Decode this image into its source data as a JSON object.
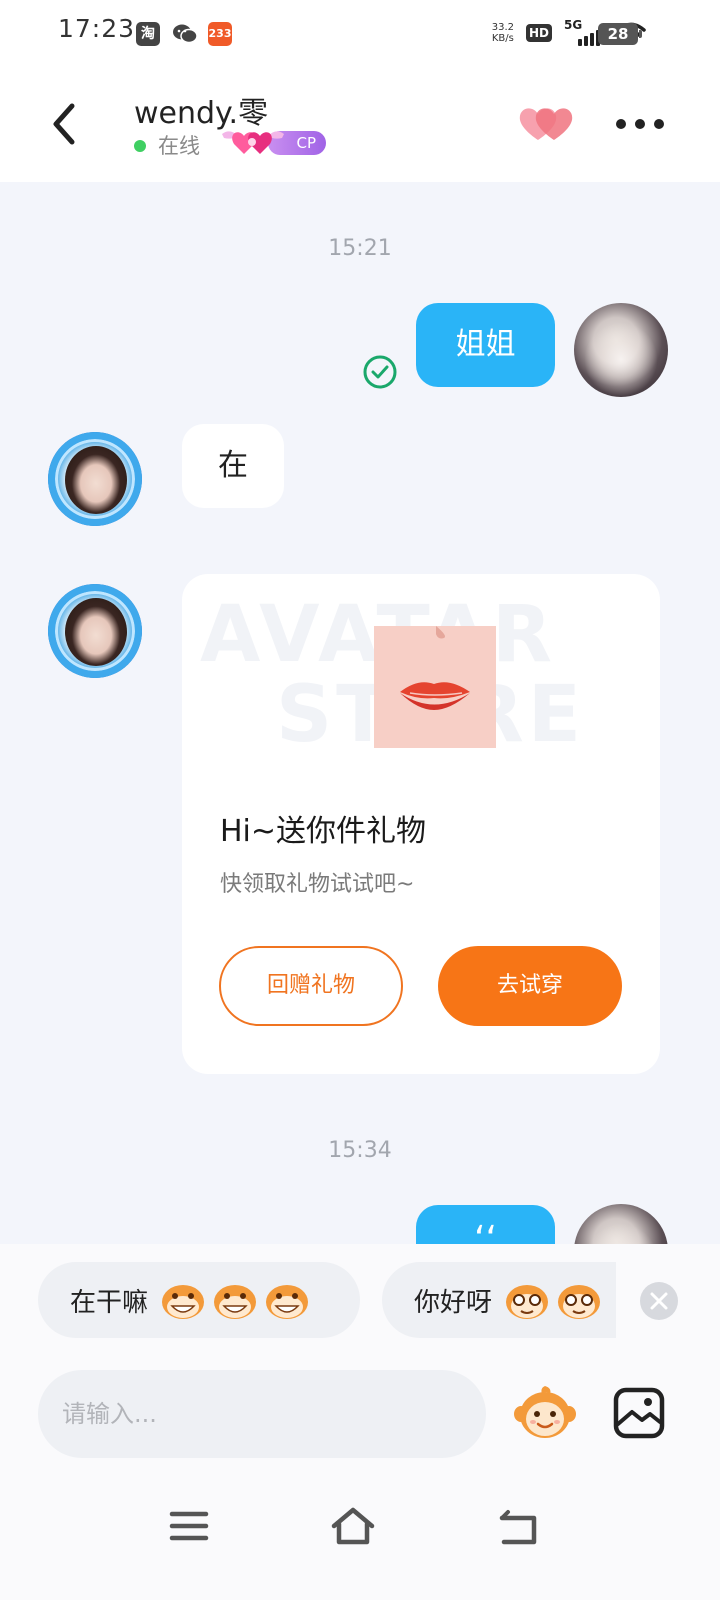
{
  "status_bar": {
    "time": "17:23",
    "apps": [
      "淘",
      "233"
    ],
    "net_speed_value": "33.2",
    "net_speed_unit": "KB/s",
    "hd": "HD",
    "signal": "5G",
    "battery": "28"
  },
  "header": {
    "contact_name": "wendy.零",
    "status": "在线",
    "badge": "CP"
  },
  "chat": {
    "messages": [
      {
        "type": "timestamp",
        "text": "15:21"
      },
      {
        "type": "outgoing",
        "text": "姐姐"
      },
      {
        "type": "incoming",
        "text": "在"
      },
      {
        "type": "gift_card",
        "title": "Hi~送你件礼物",
        "subtitle": "快领取礼物试试吧~",
        "watermark": [
          "AVATAR",
          "STORE"
        ],
        "button_secondary": "回赠礼物",
        "button_primary": "去试穿"
      },
      {
        "type": "timestamp",
        "text": "15:34"
      },
      {
        "type": "outgoing",
        "text": "‘‘"
      }
    ]
  },
  "quick_replies": [
    {
      "text": "在干嘛",
      "emoji_count": 3
    },
    {
      "text": "你好呀",
      "emoji_count": 2
    }
  ],
  "composer": {
    "placeholder": "请输入..."
  },
  "colors": {
    "accent_blue": "#2ab4f7",
    "accent_orange": "#f77516",
    "online_green": "#3fcf62"
  },
  "icons": [
    "back-icon",
    "hearts-icon",
    "more-icon",
    "read-check-icon",
    "close-icon",
    "emoji-icon",
    "image-icon",
    "menu-icon",
    "home-icon",
    "back-nav-icon"
  ]
}
